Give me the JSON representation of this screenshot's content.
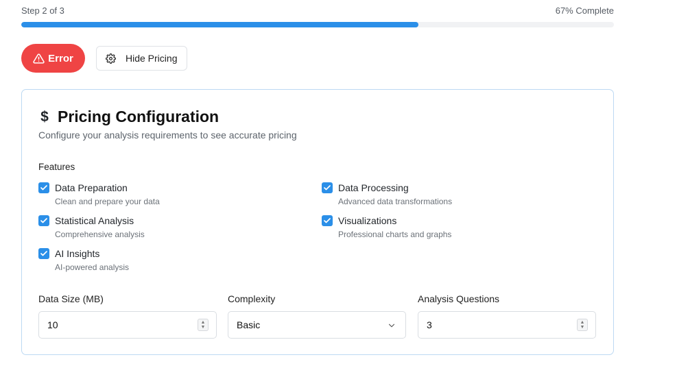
{
  "progress": {
    "step_text": "Step 2 of 3",
    "complete_text": "67% Complete",
    "value_percent": 67,
    "color": "#2b8fe8"
  },
  "actions": {
    "error_label": "Error",
    "error_color": "#ef4444",
    "toggle_pricing_label": "Hide Pricing"
  },
  "card": {
    "title": "Pricing Configuration",
    "subtitle": "Configure your analysis requirements to see accurate pricing",
    "features_label": "Features",
    "features": [
      {
        "title": "Data Preparation",
        "desc": "Clean and prepare your data",
        "checked": true
      },
      {
        "title": "Data Processing",
        "desc": "Advanced data transformations",
        "checked": true
      },
      {
        "title": "Statistical Analysis",
        "desc": "Comprehensive analysis",
        "checked": true
      },
      {
        "title": "Visualizations",
        "desc": "Professional charts and graphs",
        "checked": true
      },
      {
        "title": "AI Insights",
        "desc": "AI-powered analysis",
        "checked": true
      }
    ],
    "fields": {
      "data_size": {
        "label": "Data Size (MB)",
        "value": "10"
      },
      "complexity": {
        "label": "Complexity",
        "value": "Basic"
      },
      "questions": {
        "label": "Analysis Questions",
        "value": "3"
      }
    }
  },
  "icons": {
    "error": "alert-triangle-icon",
    "pricing_toggle": "gear-icon",
    "title": "dollar-icon",
    "checkbox": "check-icon",
    "select": "chevron-down-icon"
  }
}
